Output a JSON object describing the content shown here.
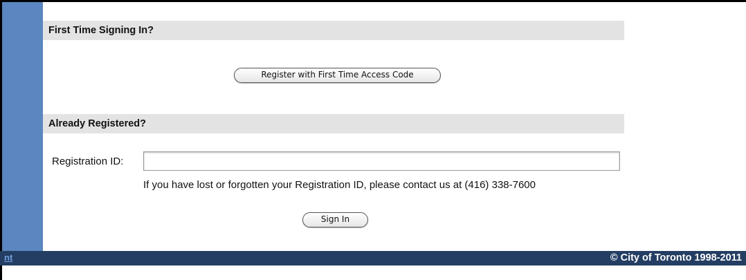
{
  "first_time": {
    "heading": "First Time Signing In?",
    "register_button": "Register with First Time Access Code"
  },
  "registered": {
    "heading": "Already Registered?",
    "registration_label": "Registration ID:",
    "registration_value": "",
    "help_text": "If you have lost or forgotten your Registration ID, please contact us at (416) 338-7600",
    "sign_in_button": "Sign In"
  },
  "footer": {
    "link_fragment": "nt",
    "copyright": "© City of Toronto 1998-2011"
  },
  "colors": {
    "rail": "#5b86bf",
    "section_header": "#e3e3e3",
    "footer_bar": "#243e63"
  }
}
